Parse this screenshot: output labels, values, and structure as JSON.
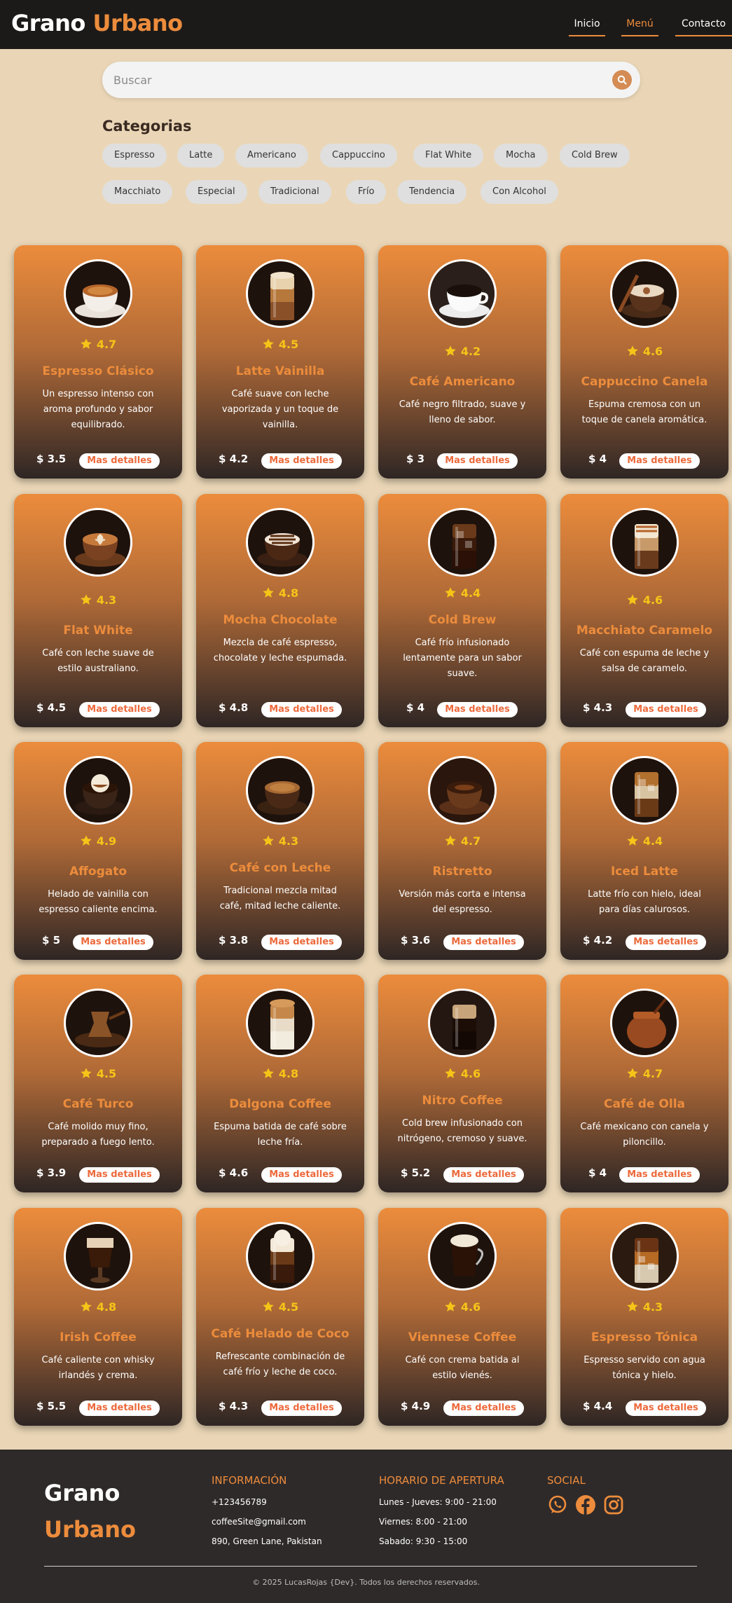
{
  "header": {
    "logo_part1": "Grano",
    "logo_part2": "Urbano",
    "nav": [
      "Inicio",
      "Menú",
      "Contacto"
    ],
    "active_nav": "Menú"
  },
  "search": {
    "placeholder": "Buscar",
    "icon": "search-icon"
  },
  "categories": {
    "title": "Categorias",
    "items": [
      "Espresso",
      "Latte",
      "Americano",
      "Cappuccino",
      "Flat White",
      "Mocha",
      "Cold Brew",
      "Macchiato",
      "Especial",
      "Tradicional",
      "Frío",
      "Tendencia",
      "Con Alcohol"
    ]
  },
  "products": [
    {
      "name": "Espresso Clásico",
      "rating": "4.7",
      "desc": "Un espresso intenso con aroma profundo y sabor equilibrado.",
      "price": "$ 3.5",
      "cta": "Mas detalles",
      "kind": "espresso"
    },
    {
      "name": "Latte Vainilla",
      "rating": "4.5",
      "desc": "Café suave con leche vaporizada y un toque de vainilla.",
      "price": "$ 4.2",
      "cta": "Mas detalles",
      "kind": "glass-latte"
    },
    {
      "name": "Café Americano",
      "rating": "4.2",
      "desc": "Café negro filtrado, suave y lleno de sabor.",
      "price": "$ 3",
      "cta": "Mas detalles",
      "kind": "americano"
    },
    {
      "name": "Cappuccino Canela",
      "rating": "4.6",
      "desc": "Espuma cremosa con un toque de canela aromática.",
      "price": "$ 4",
      "cta": "Mas detalles",
      "kind": "cappuccino"
    },
    {
      "name": "Flat White",
      "rating": "4.3",
      "desc": "Café con leche suave de estilo australiano.",
      "price": "$ 4.5",
      "cta": "Mas detalles",
      "kind": "latte-art"
    },
    {
      "name": "Mocha Chocolate",
      "rating": "4.8",
      "desc": "Mezcla de café espresso, chocolate y leche espumada.",
      "price": "$ 4.8",
      "cta": "Mas detalles",
      "kind": "mocha"
    },
    {
      "name": "Cold Brew",
      "rating": "4.4",
      "desc": "Café frío infusionado lentamente para un sabor suave.",
      "price": "$ 4",
      "cta": "Mas detalles",
      "kind": "iced-dark"
    },
    {
      "name": "Macchiato Caramelo",
      "rating": "4.6",
      "desc": "Café con espuma de leche y salsa de caramelo.",
      "price": "$ 4.3",
      "cta": "Mas detalles",
      "kind": "glass-caramel"
    },
    {
      "name": "Affogato",
      "rating": "4.9",
      "desc": "Helado de vainilla con espresso caliente encima.",
      "price": "$ 5",
      "cta": "Mas detalles",
      "kind": "affogato"
    },
    {
      "name": "Café con Leche",
      "rating": "4.3",
      "desc": "Tradicional mezcla mitad café, mitad leche caliente.",
      "price": "$ 3.8",
      "cta": "Mas detalles",
      "kind": "cup-dark"
    },
    {
      "name": "Ristretto",
      "rating": "4.7",
      "desc": "Versión más corta e intensa del espresso.",
      "price": "$ 3.6",
      "cta": "Mas detalles",
      "kind": "ristretto"
    },
    {
      "name": "Iced Latte",
      "rating": "4.4",
      "desc": "Latte frío con hielo, ideal para días calurosos.",
      "price": "$ 4.2",
      "cta": "Mas detalles",
      "kind": "iced-latte"
    },
    {
      "name": "Café Turco",
      "rating": "4.5",
      "desc": "Café molido muy fino, preparado a fuego lento.",
      "price": "$ 3.9",
      "cta": "Mas detalles",
      "kind": "turkish"
    },
    {
      "name": "Dalgona Coffee",
      "rating": "4.8",
      "desc": "Espuma batida de café sobre leche fría.",
      "price": "$ 4.6",
      "cta": "Mas detalles",
      "kind": "dalgona"
    },
    {
      "name": "Nitro Coffee",
      "rating": "4.6",
      "desc": "Cold brew infusionado con nitrógeno, cremoso y suave.",
      "price": "$ 5.2",
      "cta": "Mas detalles",
      "kind": "nitro"
    },
    {
      "name": "Café de Olla",
      "rating": "4.7",
      "desc": "Café mexicano con canela y piloncillo.",
      "price": "$ 4",
      "cta": "Mas detalles",
      "kind": "olla"
    },
    {
      "name": "Irish Coffee",
      "rating": "4.8",
      "desc": "Café caliente con whisky irlandés y crema.",
      "price": "$ 5.5",
      "cta": "Mas detalles",
      "kind": "irish"
    },
    {
      "name": "Café Helado de Coco",
      "rating": "4.5",
      "desc": "Refrescante combinación de café frío y leche de coco.",
      "price": "$ 4.3",
      "cta": "Mas detalles",
      "kind": "coco"
    },
    {
      "name": "Viennese Coffee",
      "rating": "4.6",
      "desc": "Café con crema batida al estilo vienés.",
      "price": "$ 4.9",
      "cta": "Mas detalles",
      "kind": "viennese"
    },
    {
      "name": "Espresso Tónica",
      "rating": "4.3",
      "desc": "Espresso servido con agua tónica y hielo.",
      "price": "$ 4.4",
      "cta": "Mas detalles",
      "kind": "tonic"
    }
  ],
  "footer": {
    "logo_part1": "Grano",
    "logo_part2": "Urbano",
    "info_title": "INFORMACIÓN",
    "info": [
      "+123456789",
      "coffeeSite@gmail.com",
      "890, Green Lane, Pakistan"
    ],
    "hours_title": "HORARIO DE APERTURA",
    "hours": [
      "Lunes - Jueves: 9:00 - 21:00",
      "Viernes: 8:00 - 21:00",
      "Sabado: 9:30 - 15:00"
    ],
    "social_title": "SOCIAL",
    "social": [
      "whatsapp-icon",
      "facebook-icon",
      "instagram-icon"
    ],
    "copyright": "© 2025 LucasRojas {Dev}. Todos los derechos reservados."
  },
  "colors": {
    "accent": "#ec8c3c",
    "header_bg": "#1c1a19",
    "page_bg": "#ead6b6",
    "footer_bg": "#2f2a2a",
    "star": "#f5c518"
  }
}
